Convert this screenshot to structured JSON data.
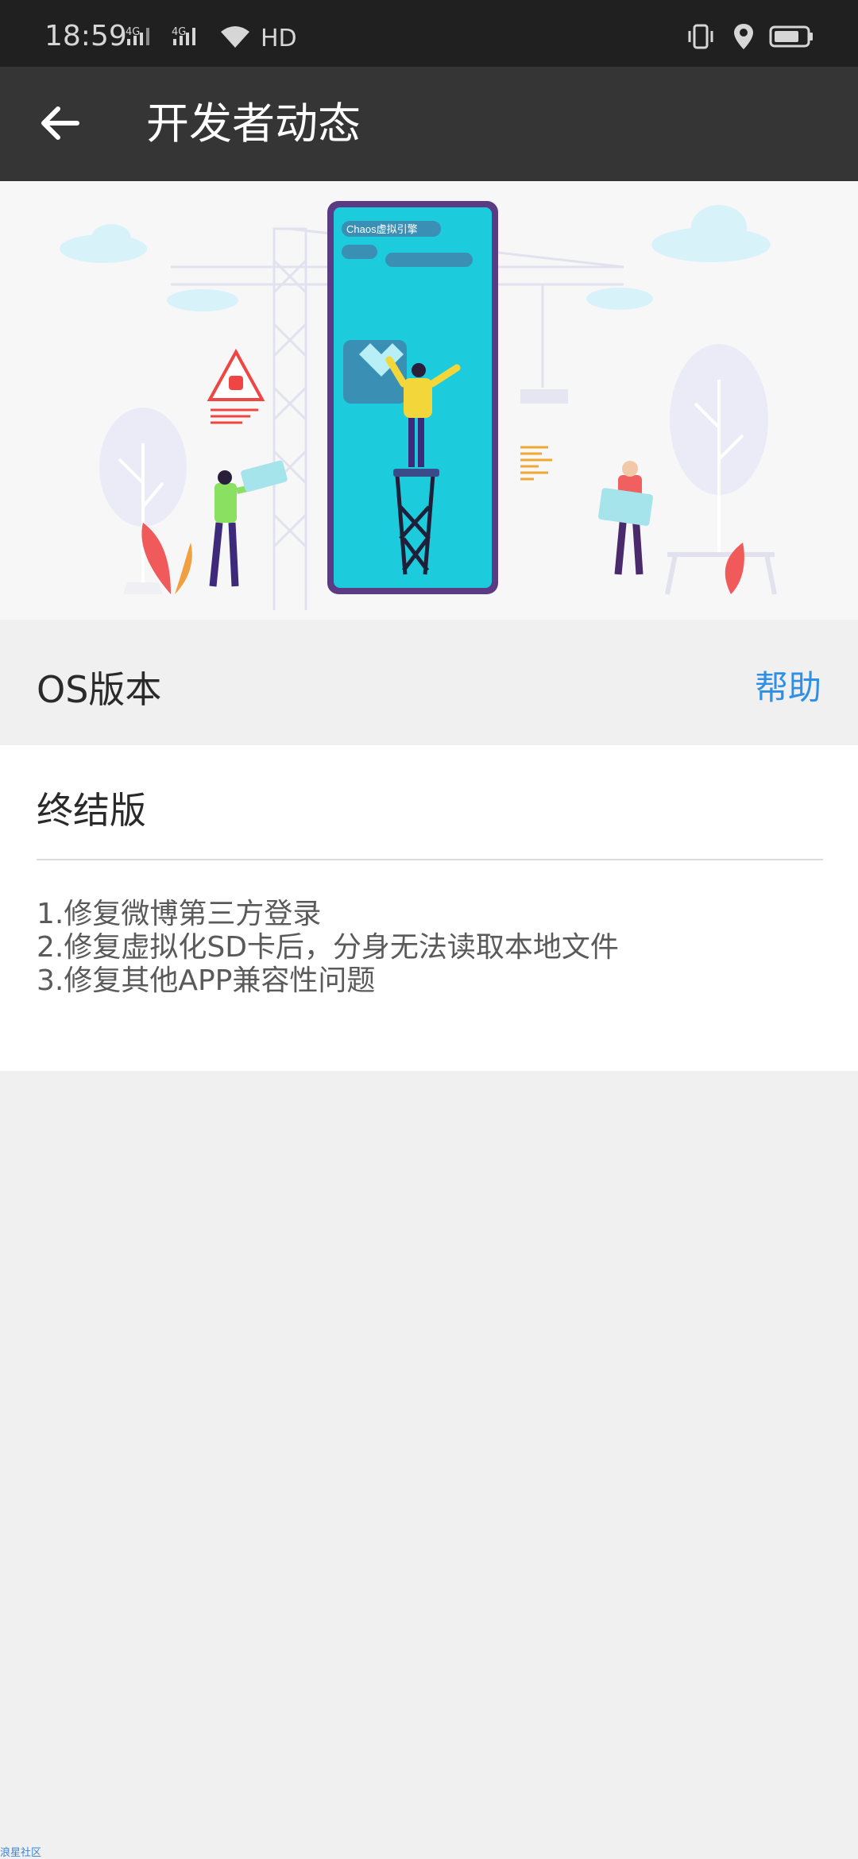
{
  "status_bar": {
    "time": "18:59",
    "network_1": "4G",
    "network_2": "4G",
    "hd_label": "HD"
  },
  "app_bar": {
    "title": "开发者动态"
  },
  "hero": {
    "screen_label": "Chaos虚拟引擎"
  },
  "os_section": {
    "label": "OS版本",
    "help": "帮助"
  },
  "release": {
    "version": "终结版",
    "notes": [
      "1.修复微博第三方登录",
      "2.修复虚拟化SD卡后，分身无法读取本地文件",
      "3.修复其他APP兼容性问题"
    ]
  },
  "watermark": "浪星社区",
  "colors": {
    "accent": "#2f8fe6",
    "toolbar": "#353535",
    "status_bar": "#202020",
    "background": "#f0f0f0"
  }
}
